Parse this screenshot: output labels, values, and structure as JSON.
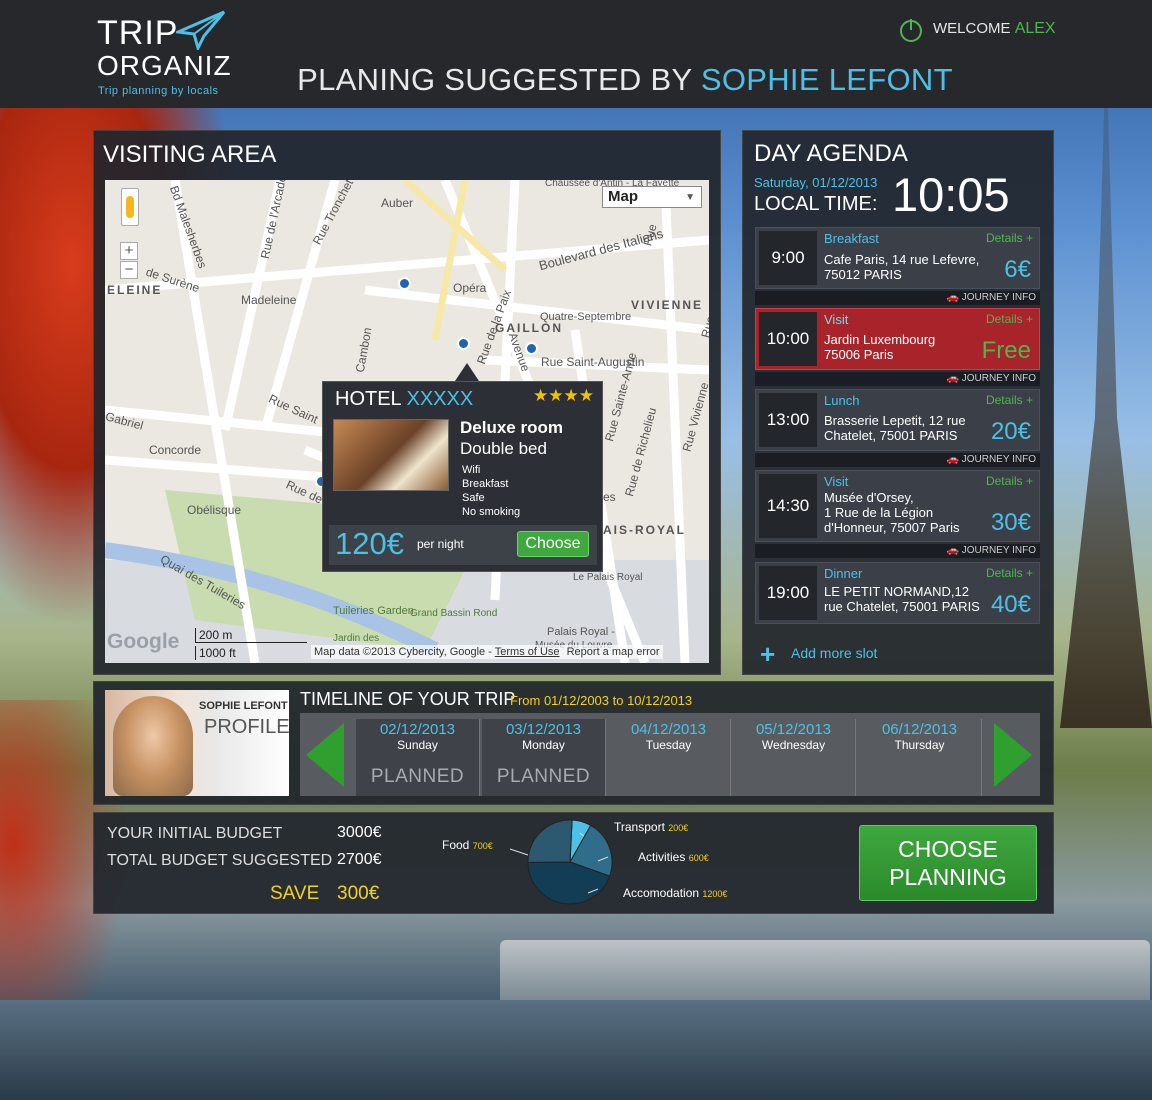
{
  "header": {
    "logo_line1": "TRIP",
    "logo_line2": "ORGANIZ",
    "tagline": "Trip planning by locals",
    "title_prefix": "PLANING SUGGESTED BY",
    "title_name": "SOPHIE LEFONT",
    "welcome_label": "WELCOME",
    "welcome_user": "ALEX"
  },
  "visiting": {
    "title": "VISITING AREA",
    "map_type": "Map",
    "scale_m": "200 m",
    "scale_ft": "1000 ft",
    "map_credit": "Map data ©2013 Cybercity, Google -",
    "terms": "Terms of Use",
    "report": "Report a map error",
    "google": "Google",
    "streets": [
      "Chaussée d'Antin - La Fayette",
      "Auber",
      "Rue Tronchet",
      "Rue de l'Arcade",
      "Bd Malesherbes",
      "de Surène",
      "ELEINE",
      "Madeleine",
      "Opéra",
      "Boulevard des Italiens",
      "VIVIENNE",
      "GAILLON",
      "Quatre-Septembre",
      "Rue Saint-Augustin",
      "Rue de la Paix",
      "Avenue",
      "Rue",
      "Rue Saint",
      "Cambon",
      "Gabriel",
      "Concorde",
      "Obélisque",
      "Rue de",
      "Quai des Tuileries",
      "Tuileries Garden",
      "Jardin des",
      "Grand Bassin Rond",
      "Palais Royal -",
      "Musée du Louvre",
      "Le Palais Royal",
      "AIS-ROYAL",
      "Rue de Richelieu",
      "Rue Vivienne",
      "Rue Sainte-Anne",
      "es",
      "Rue"
    ]
  },
  "hotel": {
    "name": "HOTEL",
    "name_mask": "XXXXX",
    "stars": "★★★★",
    "room_type": "Deluxe room",
    "bed": "Double bed",
    "amenities": [
      "Wifi",
      "Breakfast",
      "Safe",
      "No smoking"
    ],
    "price": "120€",
    "price_unit": "per night",
    "choose": "Choose"
  },
  "agenda": {
    "title": "DAY AGENDA",
    "date": "Saturday, 01/12/2013",
    "local_time_label": "LOCAL TIME:",
    "local_time": "10:05",
    "journey_info": "JOURNEY INFO",
    "add_slot": "Add more slot",
    "slots": [
      {
        "time": "9:00",
        "category": "Breakfast",
        "details": "Details +",
        "lines": [
          "Cafe Paris, 14 rue Lefevre,",
          "75012 PARIS"
        ],
        "price": "6€"
      },
      {
        "time": "10:00",
        "category": "Visit",
        "details": "Details +",
        "lines": [
          "Jardin Luxembourg",
          "75006 Paris"
        ],
        "price": "Free"
      },
      {
        "time": "13:00",
        "category": "Lunch",
        "details": "Details +",
        "lines": [
          "Brasserie Lepetit, 12 rue",
          "Chatelet, 75001 PARIS"
        ],
        "price": "20€"
      },
      {
        "time": "14:30",
        "category": "Visit",
        "details": "Details +",
        "lines": [
          "Musée d'Orsey,",
          "1 Rue de la Légion",
          "d'Honneur, 75007 Paris"
        ],
        "price": "30€"
      },
      {
        "time": "19:00",
        "category": "Dinner",
        "details": "Details +",
        "lines": [
          "LE PETIT NORMAND,12",
          "rue Chatelet, 75001 PARIS"
        ],
        "price": "40€"
      }
    ]
  },
  "profile": {
    "name": "SOPHIE LEFONT",
    "label": "PROFILE"
  },
  "timeline": {
    "title": "TIMELINE OF YOUR TRIP",
    "range": "From 01/12/2003 to 10/12/2013",
    "days": [
      {
        "date": "02/12/2013",
        "weekday": "Sunday",
        "status": "PLANNED"
      },
      {
        "date": "03/12/2013",
        "weekday": "Monday",
        "status": "PLANNED"
      },
      {
        "date": "04/12/2013",
        "weekday": "Tuesday",
        "status": ""
      },
      {
        "date": "05/12/2013",
        "weekday": "Wednesday",
        "status": ""
      },
      {
        "date": "06/12/2013",
        "weekday": "Thursday",
        "status": ""
      }
    ]
  },
  "budget": {
    "initial_label": "YOUR INITIAL BUDGET",
    "initial_value": "3000€",
    "suggested_label": "TOTAL BUDGET SUGGESTED",
    "suggested_value": "2700€",
    "save_label": "SAVE",
    "save_value": "300€",
    "choose_line1": "CHOOSE",
    "choose_line2": "PLANNING"
  },
  "chart_data": {
    "type": "pie",
    "categories": [
      "Transport",
      "Activities",
      "Accomodation",
      "Food"
    ],
    "values": [
      200,
      600,
      1200,
      700
    ],
    "labels": [
      "200€",
      "600€",
      "1200€",
      "700€"
    ]
  },
  "colors": {
    "accent_blue": "#4cc0e6",
    "accent_green": "#3fa83f",
    "header_bg": "#26282b",
    "highlight_red": "#a8232a"
  }
}
